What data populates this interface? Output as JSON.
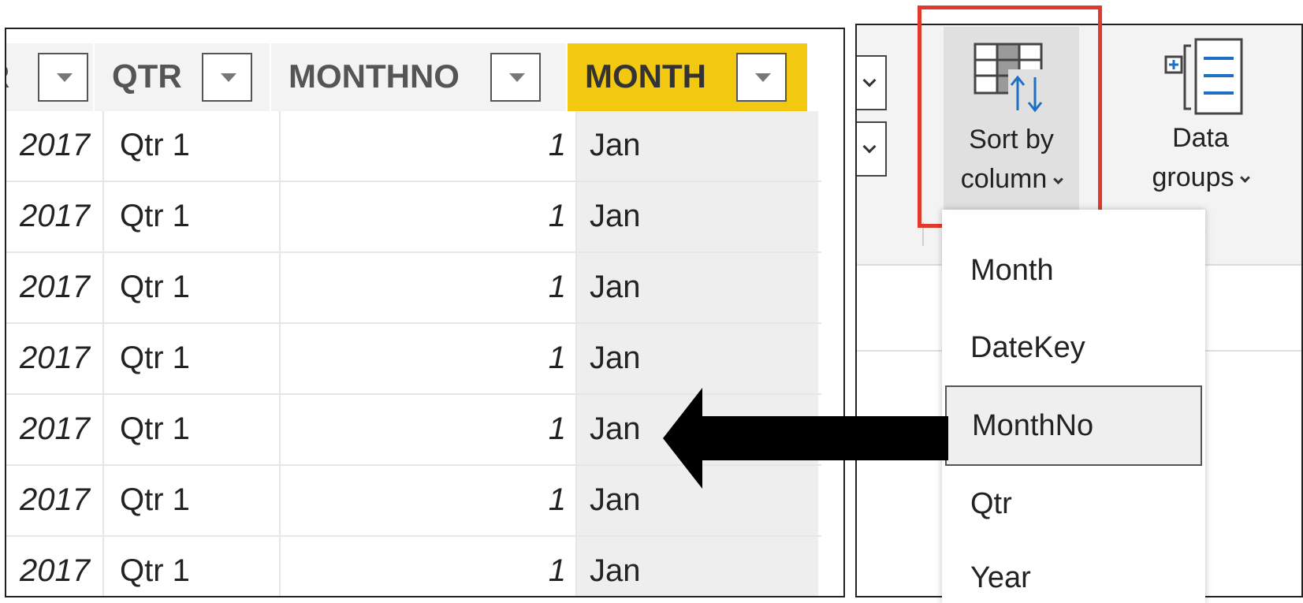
{
  "table": {
    "columns": [
      {
        "label": "R"
      },
      {
        "label": "QTR"
      },
      {
        "label": "MONTHNO"
      },
      {
        "label": "MONTH"
      }
    ],
    "rows": [
      {
        "year": "2017",
        "qtr": "Qtr 1",
        "monthno": "1",
        "month": "Jan"
      },
      {
        "year": "2017",
        "qtr": "Qtr 1",
        "monthno": "1",
        "month": "Jan"
      },
      {
        "year": "2017",
        "qtr": "Qtr 1",
        "monthno": "1",
        "month": "Jan"
      },
      {
        "year": "2017",
        "qtr": "Qtr 1",
        "monthno": "1",
        "month": "Jan"
      },
      {
        "year": "2017",
        "qtr": "Qtr 1",
        "monthno": "1",
        "month": "Jan"
      },
      {
        "year": "2017",
        "qtr": "Qtr 1",
        "monthno": "1",
        "month": "Jan"
      },
      {
        "year": "2017",
        "qtr": "Qtr 1",
        "monthno": "1",
        "month": "Jan"
      }
    ],
    "selected_column": "MONTH",
    "selected_header_color": "#f2c811"
  },
  "ribbon": {
    "sort_by_column": {
      "line1": "Sort by",
      "line2": "column"
    },
    "data_groups": {
      "line1": "Data",
      "line2": "groups"
    },
    "group_caption_partial": "ups",
    "highlight_color": "#e03a2e"
  },
  "dropdown": {
    "items": [
      {
        "label": "Month"
      },
      {
        "label": "DateKey"
      },
      {
        "label": "MonthNo"
      },
      {
        "label": "Qtr"
      },
      {
        "label": "Year"
      }
    ],
    "selected": "MonthNo"
  },
  "icons": {
    "sort": "sort-by-column-icon",
    "groups": "data-groups-icon",
    "arrow": "left-arrow-callout"
  }
}
